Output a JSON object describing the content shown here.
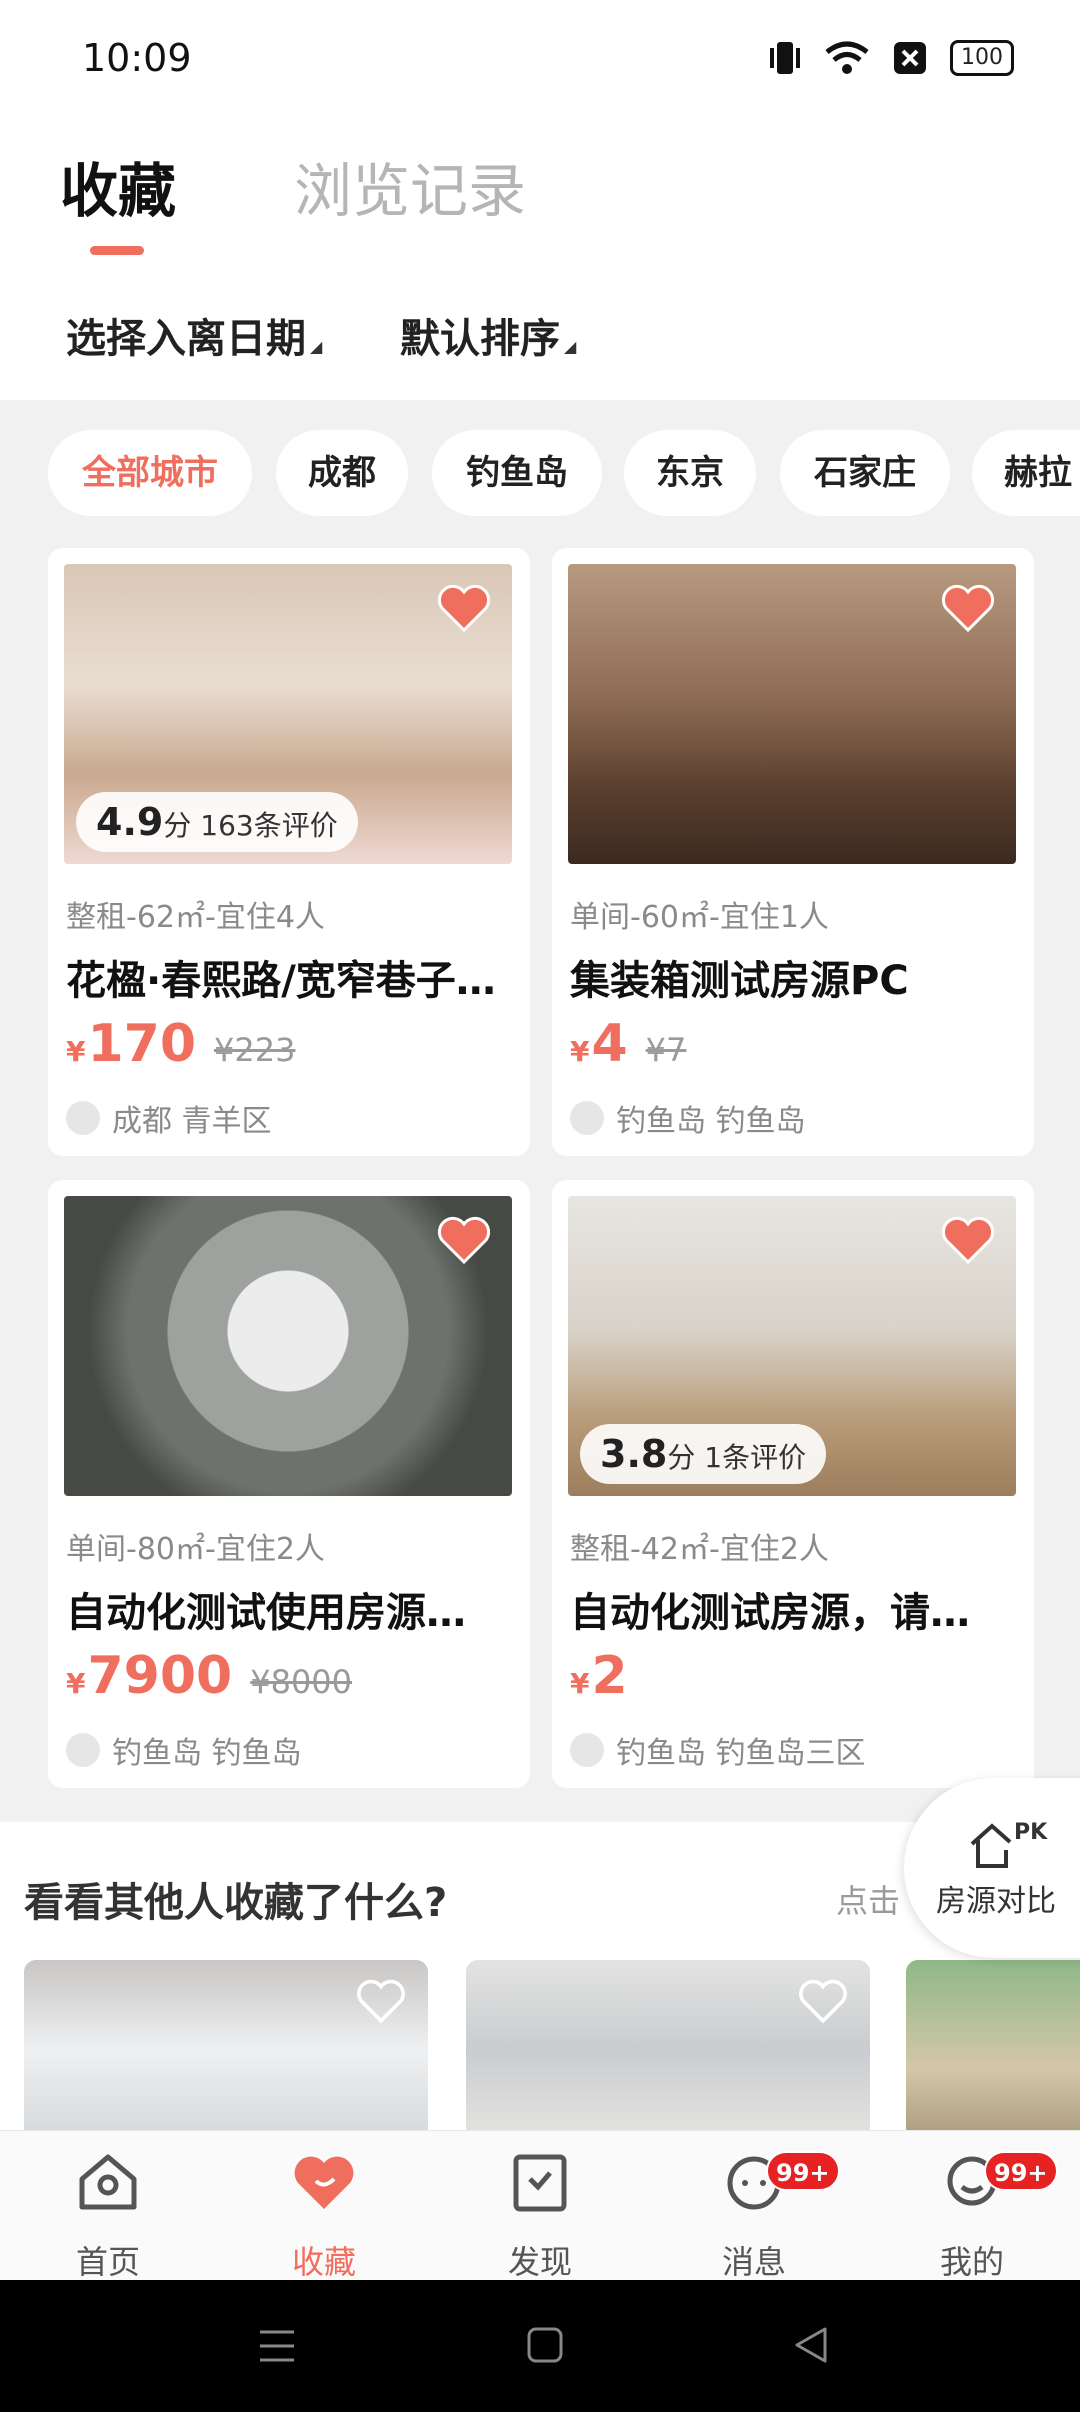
{
  "status_bar": {
    "time": "10:09",
    "battery": "100"
  },
  "tabs": {
    "active": "收藏",
    "inactive": "浏览记录"
  },
  "filters": {
    "date": "选择入离日期",
    "sort": "默认排序"
  },
  "city_chips": [
    "全部城市",
    "成都",
    "钓鱼岛",
    "东京",
    "石家庄",
    "赫拉"
  ],
  "listings": [
    {
      "rating": "4.9",
      "rating_unit": "分",
      "reviews": "163条评价",
      "meta": "整租-62㎡-宜住4人",
      "title": "花楹·春熙路/宽窄巷子…",
      "currency": "¥",
      "price": "170",
      "orig_price": "¥223",
      "location": "成都 青羊区"
    },
    {
      "rating": "",
      "rating_unit": "",
      "reviews": "",
      "meta": "单间-60㎡-宜住1人",
      "title": "集装箱测试房源PC",
      "currency": "¥",
      "price": "4",
      "orig_price": "¥7",
      "location": "钓鱼岛 钓鱼岛"
    },
    {
      "rating": "",
      "rating_unit": "",
      "reviews": "",
      "meta": "单间-80㎡-宜住2人",
      "title": "自动化测试使用房源…",
      "currency": "¥",
      "price": "7900",
      "orig_price": "¥8000",
      "location": "钓鱼岛 钓鱼岛"
    },
    {
      "rating": "3.8",
      "rating_unit": "分",
      "reviews": "1条评价",
      "meta": "整租-42㎡-宜住2人",
      "title": "自动化测试房源，请…",
      "currency": "¥",
      "price": "2",
      "orig_price": "",
      "location": "钓鱼岛 钓鱼岛三区"
    }
  ],
  "others": {
    "heading": "看看其他人收藏了什么?",
    "more": "点击"
  },
  "compare_button": {
    "label": "房源对比",
    "badge": "PK"
  },
  "bottom_nav": [
    {
      "label": "首页",
      "icon": "home-icon",
      "badge": ""
    },
    {
      "label": "收藏",
      "icon": "heart-icon",
      "badge": ""
    },
    {
      "label": "发现",
      "icon": "discover-icon",
      "badge": ""
    },
    {
      "label": "消息",
      "icon": "message-icon",
      "badge": "99+"
    },
    {
      "label": "我的",
      "icon": "profile-icon",
      "badge": "99+"
    }
  ],
  "colors": {
    "accent": "#f06e5e",
    "badge": "#e62222"
  }
}
